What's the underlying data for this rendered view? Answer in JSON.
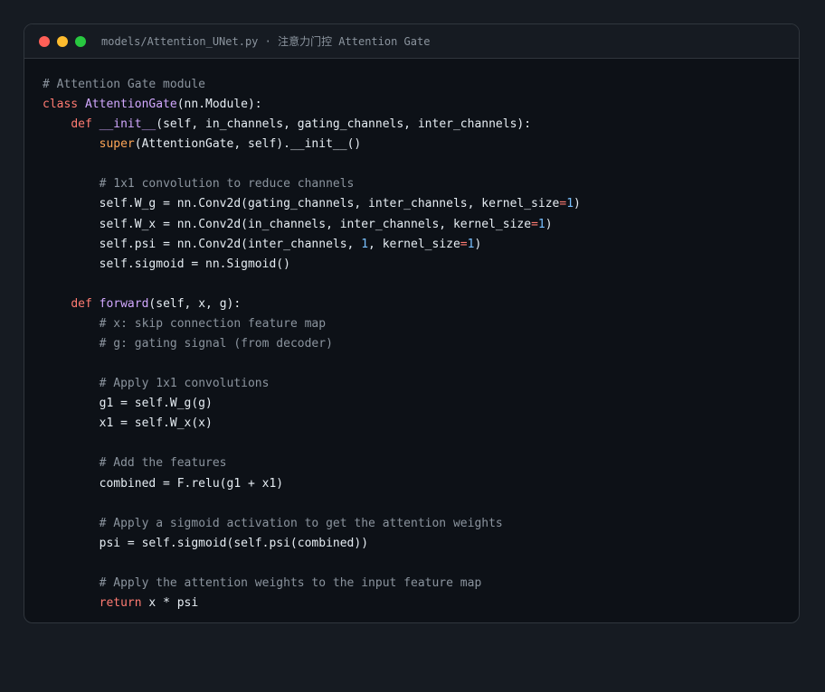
{
  "window": {
    "title": "models/Attention_UNet.py · 注意力门控 Attention Gate",
    "controls": [
      {
        "name": "close",
        "color": "#ff5f57"
      },
      {
        "name": "minimize",
        "color": "#febc2e"
      },
      {
        "name": "maximize",
        "color": "#28c840"
      }
    ]
  },
  "theme": {
    "text": "#e6edf3",
    "comment": "#8b949e",
    "keyword": "#ff7b72",
    "function": "#d2a8ff",
    "builtin": "#ffa657",
    "number": "#79c0ff",
    "operator": "#ff7b72"
  },
  "code": [
    [
      [
        "comment",
        "# Attention Gate module"
      ]
    ],
    [
      [
        "keyword",
        "class"
      ],
      [
        "text",
        " "
      ],
      [
        "function",
        "AttentionGate"
      ],
      [
        "text",
        "(nn.Module):"
      ]
    ],
    [
      [
        "text",
        "    "
      ],
      [
        "keyword",
        "def"
      ],
      [
        "text",
        " "
      ],
      [
        "function",
        "__init__"
      ],
      [
        "text",
        "(self, in_channels, gating_channels, inter_channels):"
      ]
    ],
    [
      [
        "text",
        "        "
      ],
      [
        "builtin",
        "super"
      ],
      [
        "text",
        "(AttentionGate, self).__init__()"
      ]
    ],
    [],
    [
      [
        "text",
        "        "
      ],
      [
        "comment",
        "# 1x1 convolution to reduce channels"
      ]
    ],
    [
      [
        "text",
        "        self.W_g "
      ],
      [
        "text",
        "= nn.Conv2d(gating_channels, inter_channels, kernel_size"
      ],
      [
        "operator",
        "="
      ],
      [
        "number",
        "1"
      ],
      [
        "text",
        ")"
      ]
    ],
    [
      [
        "text",
        "        self.W_x "
      ],
      [
        "text",
        "= nn.Conv2d(in_channels, inter_channels, kernel_size"
      ],
      [
        "operator",
        "="
      ],
      [
        "number",
        "1"
      ],
      [
        "text",
        ")"
      ]
    ],
    [
      [
        "text",
        "        self.psi "
      ],
      [
        "text",
        "= nn.Conv2d(inter_channels, "
      ],
      [
        "number",
        "1"
      ],
      [
        "text",
        ", kernel_size"
      ],
      [
        "operator",
        "="
      ],
      [
        "number",
        "1"
      ],
      [
        "text",
        ")"
      ]
    ],
    [
      [
        "text",
        "        self.sigmoid = nn.Sigmoid()"
      ]
    ],
    [],
    [
      [
        "text",
        "    "
      ],
      [
        "keyword",
        "def"
      ],
      [
        "text",
        " "
      ],
      [
        "function",
        "forward"
      ],
      [
        "text",
        "(self, x, g):"
      ]
    ],
    [
      [
        "text",
        "        "
      ],
      [
        "comment",
        "# x: skip connection feature map"
      ]
    ],
    [
      [
        "text",
        "        "
      ],
      [
        "comment",
        "# g: gating signal (from decoder)"
      ]
    ],
    [],
    [
      [
        "text",
        "        "
      ],
      [
        "comment",
        "# Apply 1x1 convolutions"
      ]
    ],
    [
      [
        "text",
        "        g1 = self.W_g(g)"
      ]
    ],
    [
      [
        "text",
        "        x1 = self.W_x(x)"
      ]
    ],
    [],
    [
      [
        "text",
        "        "
      ],
      [
        "comment",
        "# Add the features"
      ]
    ],
    [
      [
        "text",
        "        combined = F.relu(g1 + x1)"
      ]
    ],
    [],
    [
      [
        "text",
        "        "
      ],
      [
        "comment",
        "# Apply a sigmoid activation to get the attention weights"
      ]
    ],
    [
      [
        "text",
        "        psi = self.sigmoid(self.psi(combined))"
      ]
    ],
    [],
    [
      [
        "text",
        "        "
      ],
      [
        "comment",
        "# Apply the attention weights to the input feature map"
      ]
    ],
    [
      [
        "text",
        "        "
      ],
      [
        "keyword",
        "return"
      ],
      [
        "text",
        " x * psi"
      ]
    ]
  ]
}
